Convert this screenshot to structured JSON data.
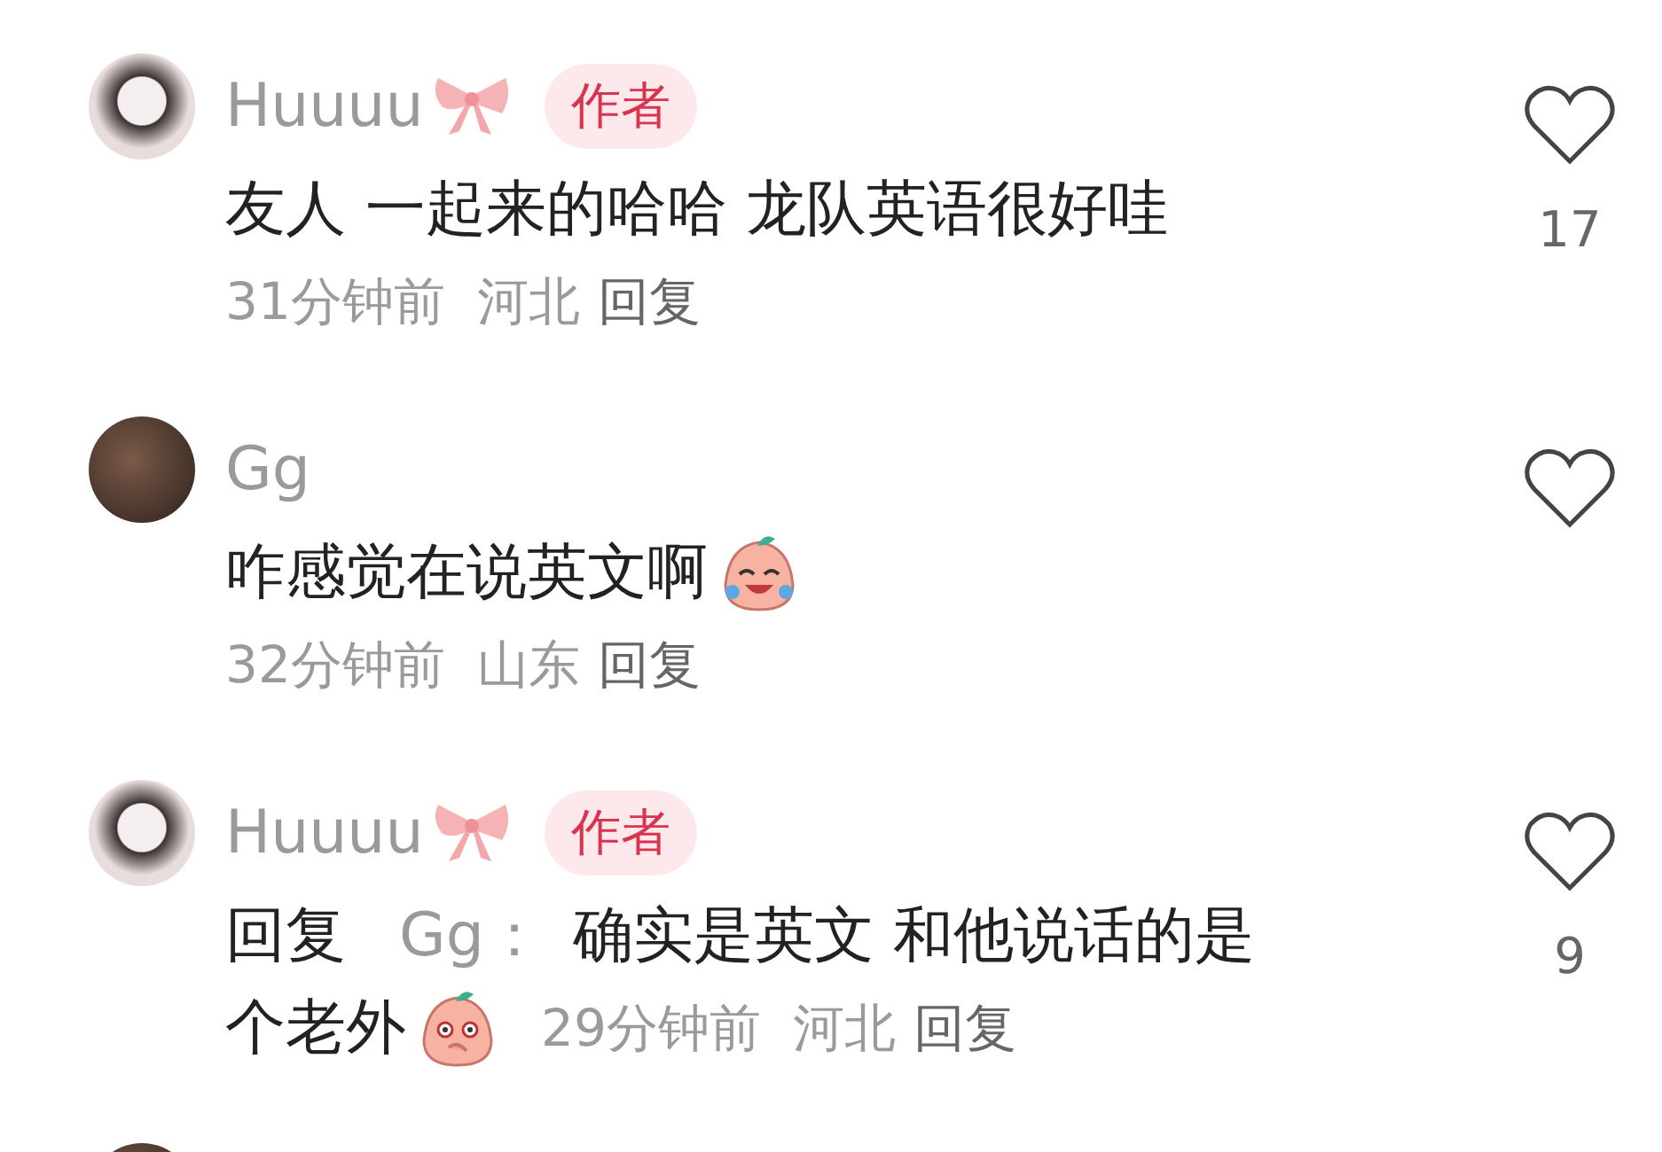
{
  "comments": [
    {
      "author": "Huuuu",
      "bow": true,
      "badge": "作者",
      "text_lines": [
        "友人 一起来的哈哈 龙队英语很好哇"
      ],
      "time": "31分钟前",
      "region": "河北",
      "reply": "回复",
      "likes": "17"
    },
    {
      "author": "Gg",
      "bow": false,
      "text_lines": [
        "咋感觉在说英文啊"
      ],
      "emoji": {
        "kind": "crying"
      },
      "time": "32分钟前",
      "region": "山东",
      "reply": "回复"
    },
    {
      "author": "Huuuu",
      "bow": true,
      "badge": "作者",
      "reply_label": "回复",
      "reply_to": "Gg：",
      "text_lines": [
        "确实是英文 和他说话的是",
        "个老外"
      ],
      "emoji": {
        "kind": "shy"
      },
      "time": "29分钟前",
      "region": "河北",
      "reply": "回复",
      "likes": "9"
    },
    {
      "bow": false
    }
  ]
}
